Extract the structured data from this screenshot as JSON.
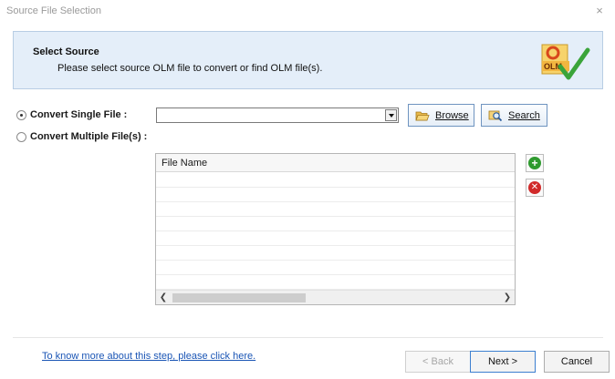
{
  "window": {
    "title": "Source File Selection",
    "close_glyph": "×"
  },
  "header": {
    "title": "Select Source",
    "subtitle": "Please select source OLM file to convert or find OLM file(s).",
    "logo_text": "OLM"
  },
  "options": {
    "single_label": "Convert Single File :",
    "multiple_label": "Convert Multiple File(s) :",
    "selected": "single"
  },
  "file_combo": {
    "value": ""
  },
  "buttons": {
    "browse_label": "Browse",
    "search_label": "Search"
  },
  "file_grid": {
    "columns": [
      "File Name"
    ],
    "rows": []
  },
  "footer": {
    "help_link": "To know more about this step, please click here.",
    "back_label": "< Back",
    "next_label": "Next >",
    "cancel_label": "Cancel"
  },
  "icons": {
    "add": "add-icon",
    "remove": "remove-icon",
    "browse": "folder-open-icon",
    "search": "search-icon"
  },
  "colors": {
    "header_bg": "#e4eef9",
    "link": "#1a55b5",
    "add": "#2f9a2f",
    "remove": "#d12a2a"
  }
}
